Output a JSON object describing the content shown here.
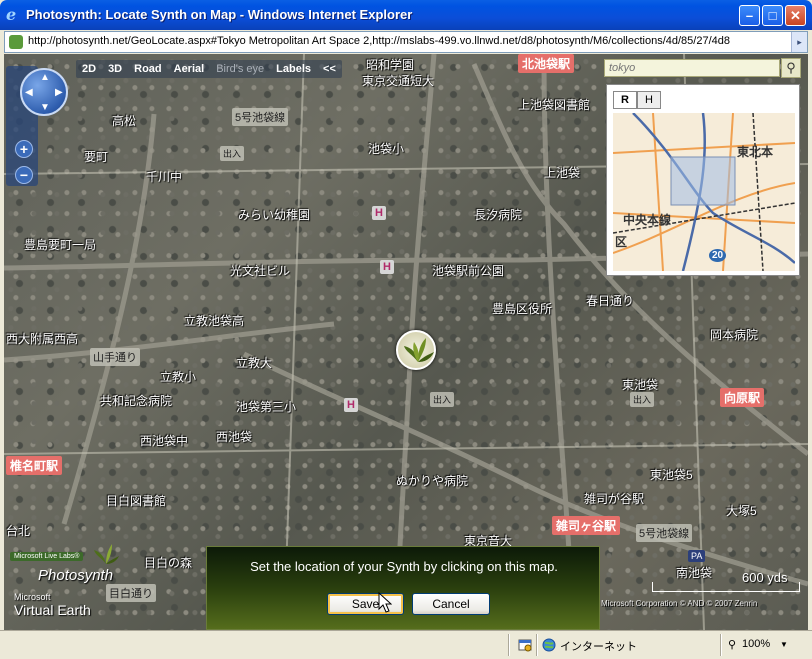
{
  "window": {
    "title": "Photosynth: Locate Synth on Map - Windows Internet Explorer",
    "min_glyph": "–",
    "max_glyph": "□",
    "close_glyph": "✕"
  },
  "address": {
    "url": "http://photosynth.net/GeoLocate.aspx#Tokyo Metropolitan Art Space 2,http://mslabs-499.vo.llnwd.net/d8/photosynth/M6/collections/4d/85/27/4d8"
  },
  "map_toolbar": {
    "items": [
      "2D",
      "3D",
      "Road",
      "Aerial",
      "Bird's eye",
      "Labels",
      "<<"
    ]
  },
  "search": {
    "placeholder": "tokyo"
  },
  "minimap": {
    "tabs": [
      "R",
      "H"
    ],
    "labels": [
      "東北本",
      "中央本線",
      "区",
      "20"
    ]
  },
  "map_labels": {
    "places": [
      "昭和学園",
      "東京交通短大",
      "高松",
      "要町",
      "千川中",
      "池袋小",
      "上池袋",
      "長汐病院",
      "豊島要町一局",
      "池袋駅前公園",
      "豊島区役所",
      "春日通り",
      "西大附属西高",
      "立教池袋高",
      "立教大",
      "岡本病院",
      "山手通り",
      "立教小",
      "共和記念病院",
      "池袋第三小",
      "西池袋",
      "東池袋",
      "西池袋中",
      "目白図書館",
      "目白の森",
      "目白通り",
      "ぬかりや病院",
      "南池袋",
      "大塚5",
      "東池袋5",
      "東京音大",
      "上池袋図書館",
      "みらい幼稚園",
      "光文社ビル",
      "台北",
      "雑司が谷駅"
    ],
    "stations": [
      "北池袋駅",
      "向原駅",
      "椎名町駅",
      "雑司ヶ谷駅"
    ],
    "routes": [
      "5号池袋線",
      "5号池袋線"
    ],
    "pois": [
      "出入",
      "出入",
      "出入",
      "H",
      "H",
      "H",
      "PA"
    ]
  },
  "branding": {
    "live_labs": "Microsoft Live Labs®",
    "product": "Photosynth",
    "ve_small": "Microsoft",
    "ve_big": "Virtual Earth",
    "copyright": "Microsoft Corporation  © AND  © 2007 Zenrin",
    "scale": "600 yds"
  },
  "dialog": {
    "message": "Set the location of your Synth by clicking on this map.",
    "save": "Save",
    "cancel": "Cancel"
  },
  "statusbar": {
    "zone": "インターネット",
    "zoom": "100%",
    "zoom_arrow": "▼"
  }
}
